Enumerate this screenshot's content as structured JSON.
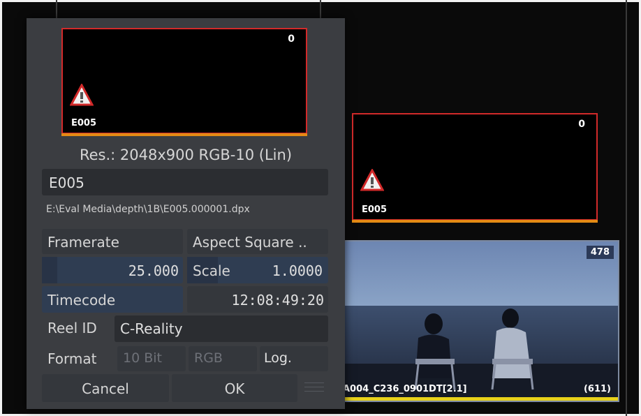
{
  "dialog": {
    "preview": {
      "name": "E005",
      "frame_count": "0"
    },
    "resolution": "Res.: 2048x900 RGB-10 (Lin)",
    "clip_name": "E005",
    "file_path": "E:\\Eval Media\\depth\\1B\\E005.000001.dpx",
    "framerate_label": "Framerate",
    "aspect_label": "Aspect Square ..",
    "framerate_value": "25.000",
    "scale_label": "Scale",
    "scale_value": "1.0000",
    "timecode_label": "Timecode",
    "timecode_value": "12:08:49:20",
    "reel_label": "Reel ID",
    "reel_value": "C-Reality",
    "format_label": "Format",
    "format_options": [
      "10 Bit",
      "RGB",
      "Log."
    ],
    "cancel_label": "Cancel",
    "ok_label": "OK"
  },
  "background_clips": [
    {
      "name": "E005",
      "frame_count": "0"
    },
    {
      "name": "A004_C236_0901DT[2.1]",
      "frame_count": "478",
      "frames_total": "(611)"
    }
  ],
  "colors": {
    "error_border": "#d22a2a",
    "orange_bar": "#e38a14",
    "yellow_bar": "#e8d21a",
    "dialog_bg": "#3b3d41"
  },
  "icons": [
    "warning-icon"
  ]
}
